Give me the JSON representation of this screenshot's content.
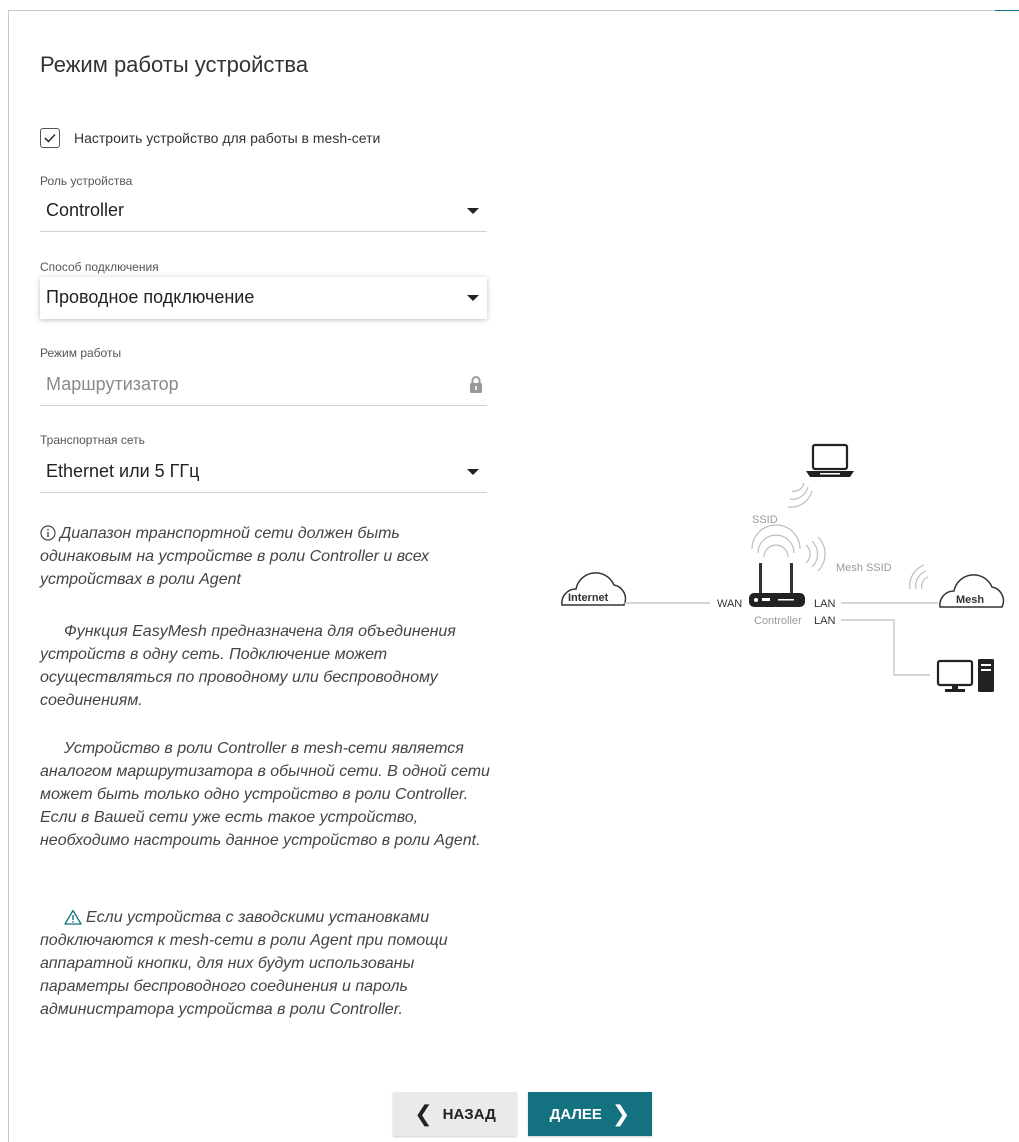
{
  "page": {
    "title": "Режим работы устройства"
  },
  "mesh_checkbox": {
    "label": "Настроить устройство для работы в mesh-сети",
    "checked": true
  },
  "fields": {
    "role": {
      "label": "Роль устройства",
      "value": "Controller"
    },
    "connection": {
      "label": "Способ подключения",
      "value": "Проводное подключение"
    },
    "mode": {
      "label": "Режим работы",
      "value": "Маршрутизатор"
    },
    "transport": {
      "label": "Транспортная сеть",
      "value": "Ethernet или 5 ГГц"
    }
  },
  "info": {
    "note": "Диапазон транспортной сети должен быть одинаковым на устройстве в роли Controller и всех устройствах в роли Agent",
    "para1": "Функция EasyMesh предназначена для объединения устройств в одну сеть. Подключение может осуществляться по проводному или беспроводному соединениям.",
    "para2": "Устройство в роли Controller в mesh-сети является аналогом маршрутизатора в обычной сети. В одной сети может быть только одно устройство в роли Controller. Если в Вашей сети уже есть такое устройство, необходимо настроить данное устройство в роли Agent.",
    "warning": "Если устройства с заводскими установками подключаются к mesh-сети в роли Agent при помощи аппаратной кнопки, для них будут использованы параметры беспроводного соединения и пароль администратора устройства в роли Controller."
  },
  "diagram": {
    "internet": "Internet",
    "mesh": "Mesh",
    "ssid": "SSID",
    "mesh_ssid": "Mesh SSID",
    "wan": "WAN",
    "lan1": "LAN",
    "lan2": "LAN",
    "controller": "Controller"
  },
  "buttons": {
    "back": "НАЗАД",
    "next": "ДАЛЕЕ"
  },
  "colors": {
    "accent": "#14717f",
    "button_back_bg": "#eaeaea"
  }
}
